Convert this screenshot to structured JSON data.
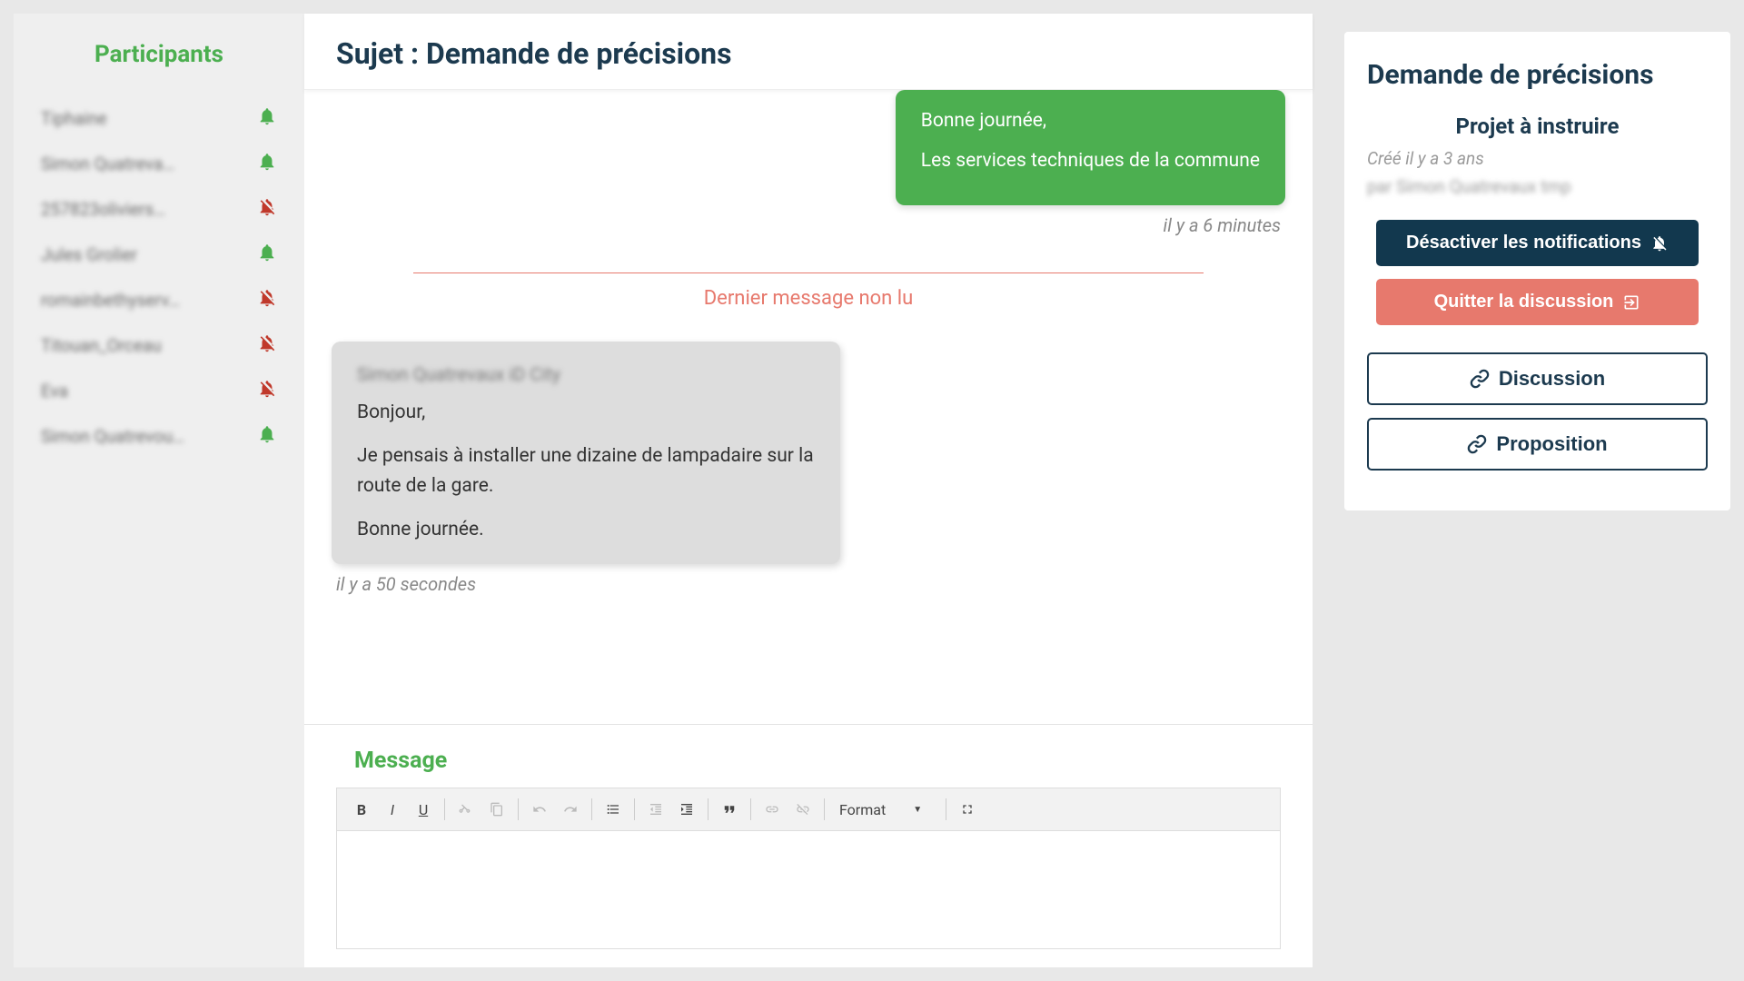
{
  "sidebar": {
    "title": "Participants",
    "items": [
      {
        "name": "Tiphaine",
        "status": "on"
      },
      {
        "name": "Simon Quatreva…",
        "status": "on"
      },
      {
        "name": "257823oliviers…",
        "status": "off"
      },
      {
        "name": "Jules Grolier",
        "status": "on"
      },
      {
        "name": "romainbethyserv…",
        "status": "off"
      },
      {
        "name": "Titouan_Orceau",
        "status": "off"
      },
      {
        "name": "Eva",
        "status": "off"
      },
      {
        "name": "Simon Quatrevou…",
        "status": "on"
      }
    ]
  },
  "subject": {
    "prefix": "Sujet : ",
    "text": "Demande de précisions"
  },
  "messages": {
    "sent": {
      "lines": [
        "Bonne journée,",
        "Les services techniques de la commune"
      ],
      "time": "il y a 6 minutes"
    },
    "unread_divider": "Dernier message non lu",
    "received": {
      "author": "Simon Quatrevaux iD City",
      "lines": [
        "Bonjour,",
        "Je pensais à installer une dizaine de lampadaire sur la route de la gare.",
        "Bonne journée."
      ],
      "time": "il y a 50 secondes"
    }
  },
  "composer": {
    "title": "Message",
    "format_label": "Format"
  },
  "right": {
    "title": "Demande de précisions",
    "subtitle": "Projet à instruire",
    "created": "Créé il y a 3 ans",
    "author": "par Simon Quatrevaux tmp",
    "disable_notif": "Désactiver les notifications",
    "quit": "Quitter la discussion",
    "discussion": "Discussion",
    "proposition": "Proposition"
  }
}
